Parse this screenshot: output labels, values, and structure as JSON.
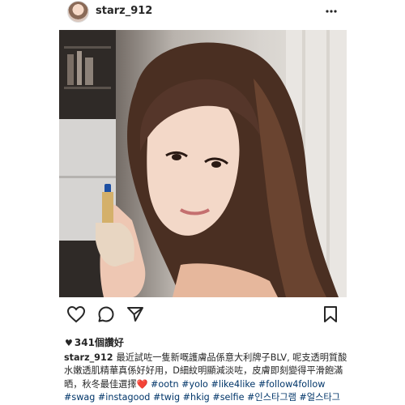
{
  "post": {
    "username": "starz_912",
    "likes_text": "341個讚好",
    "caption_user": "starz_912",
    "caption_text": "最近試咗一隻新嘅護膚品係意大利牌子BLV, 呢支透明質酸水嫩透肌精華真係好好用，D細紋明顯減淡咗，皮膚即刻變得平滑飽滿晒，秋冬最佳選擇",
    "hashtags_text": "#ootn #yolo #like4like #follow4follow #swag #instagood #twig #hkig #selfie #인스타그램 #얼스타그램 #셀스타그램 #셀카 #셀피 #팔로",
    "heart_emoji": "❤️"
  },
  "icons": {
    "more": "more-dots-icon",
    "like": "heart-outline-icon",
    "comment": "comment-icon",
    "share": "send-icon",
    "save": "bookmark-icon",
    "likes_heart": "heart-filled-icon"
  }
}
